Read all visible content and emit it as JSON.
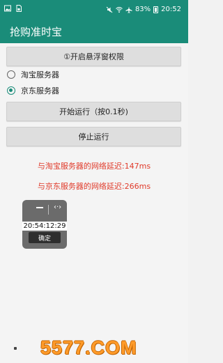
{
  "status_bar": {
    "battery_text": "83%",
    "time": "20:52",
    "icons": [
      "gallery-icon",
      "sim-icon",
      "mute-icon",
      "wifi-icon",
      "airplane-icon",
      "battery-icon"
    ]
  },
  "app_bar": {
    "title": "抢购准时宝"
  },
  "buttons": {
    "permission": "①开启悬浮窗权限",
    "start": "开始运行（按0.1秒)",
    "stop": "停止运行"
  },
  "servers": {
    "options": [
      {
        "label": "淘宝服务器",
        "checked": false
      },
      {
        "label": "京东服务器",
        "checked": true
      }
    ]
  },
  "latency": {
    "taobao": "与淘宝服务器的网络延迟:147ms",
    "jd": "与京东服务器的网络延迟:266ms"
  },
  "float_widget": {
    "time": "20:54:12:29",
    "confirm": "确定",
    "move_glyph": "‹·›"
  },
  "watermark": {
    "text": "5577.COM"
  },
  "colors": {
    "primary": "#1a8c79",
    "latency_red": "#e03a2a",
    "button_gray": "#dedede",
    "widget_bg": "#6b6b6b"
  }
}
